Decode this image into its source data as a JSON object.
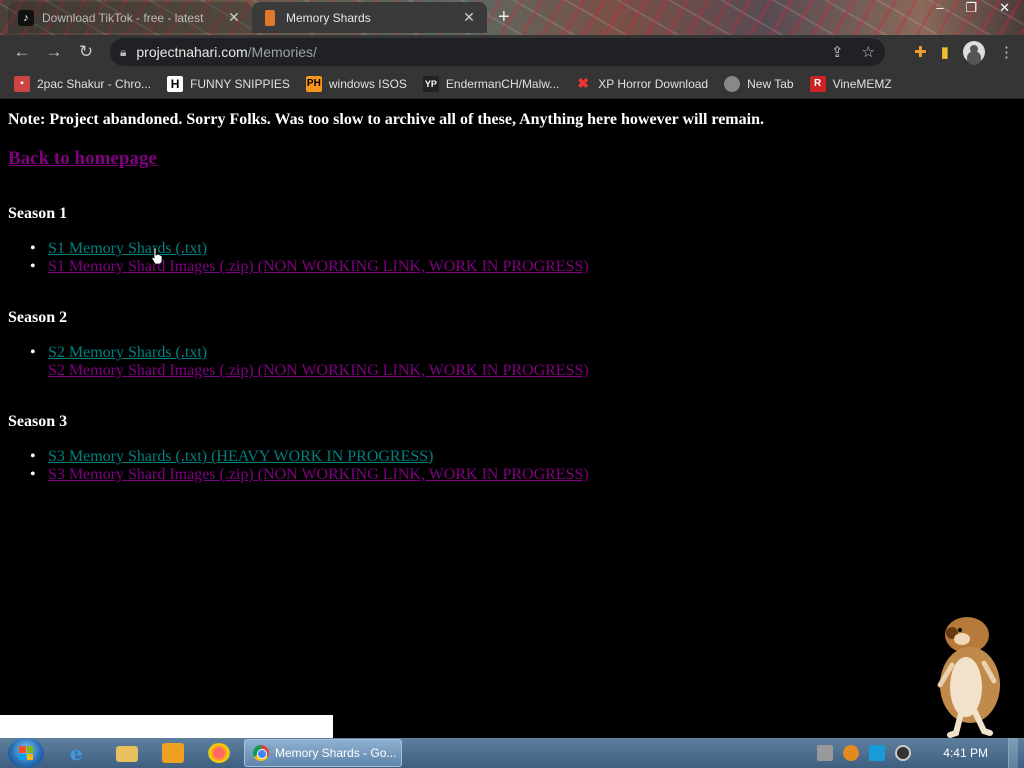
{
  "browser": {
    "tabs": [
      {
        "title": "Download TikTok - free - latest",
        "active": false
      },
      {
        "title": "Memory Shards",
        "active": true
      }
    ],
    "new_tab_symbol": "+",
    "window_controls": {
      "minimize": "–",
      "maximize": "❐",
      "close": "✕"
    },
    "url_host": "projectnahari.com",
    "url_path": "/Memories/",
    "bookmarks": [
      {
        "label": "2pac Shakur - Chro...",
        "icon": "2pac-favicon"
      },
      {
        "label": "FUNNY SNIPPIES",
        "icon": "h-favicon"
      },
      {
        "label": "windows ISOS",
        "icon": "ph-favicon"
      },
      {
        "label": "EndermanCH/Malw...",
        "icon": "yp-favicon"
      },
      {
        "label": "XP Horror Download",
        "icon": "x-favicon"
      },
      {
        "label": "New Tab",
        "icon": "globe-favicon"
      },
      {
        "label": "VineMEMZ",
        "icon": "r-favicon"
      }
    ]
  },
  "page": {
    "note": "Note: Project abandoned. Sorry Folks. Was too slow to archive all of these, Anything here however will remain.",
    "home_link": "Back to homepage",
    "seasons": [
      {
        "heading": "Season 1",
        "links": [
          {
            "text": "S1 Memory Shards (.txt)",
            "color": "#008080"
          },
          {
            "text": "S1 Memory Shard Images (.zip) (NON WORKING LINK, WORK IN PROGRESS)",
            "color": "#800080"
          }
        ]
      },
      {
        "heading": "Season 2",
        "links": [
          {
            "text": "S2 Memory Shards (.txt)",
            "color": "#008080"
          },
          {
            "text": "S2 Memory Shard Images (.zip) (NON WORKING LINK, WORK IN PROGRESS)",
            "color": "#800080"
          }
        ]
      },
      {
        "heading": "Season 3",
        "links": [
          {
            "text": "S3 Memory Shards (.txt) (HEAVY WORK IN PROGRESS)",
            "color": "#008080"
          },
          {
            "text": "S3 Memory Shard Images (.zip) (NON WORKING LINK, WORK IN PROGRESS)",
            "color": "#800080"
          }
        ]
      }
    ]
  },
  "taskbar": {
    "task_label": "Memory Shards - Go...",
    "clock": "4:41 PM"
  }
}
